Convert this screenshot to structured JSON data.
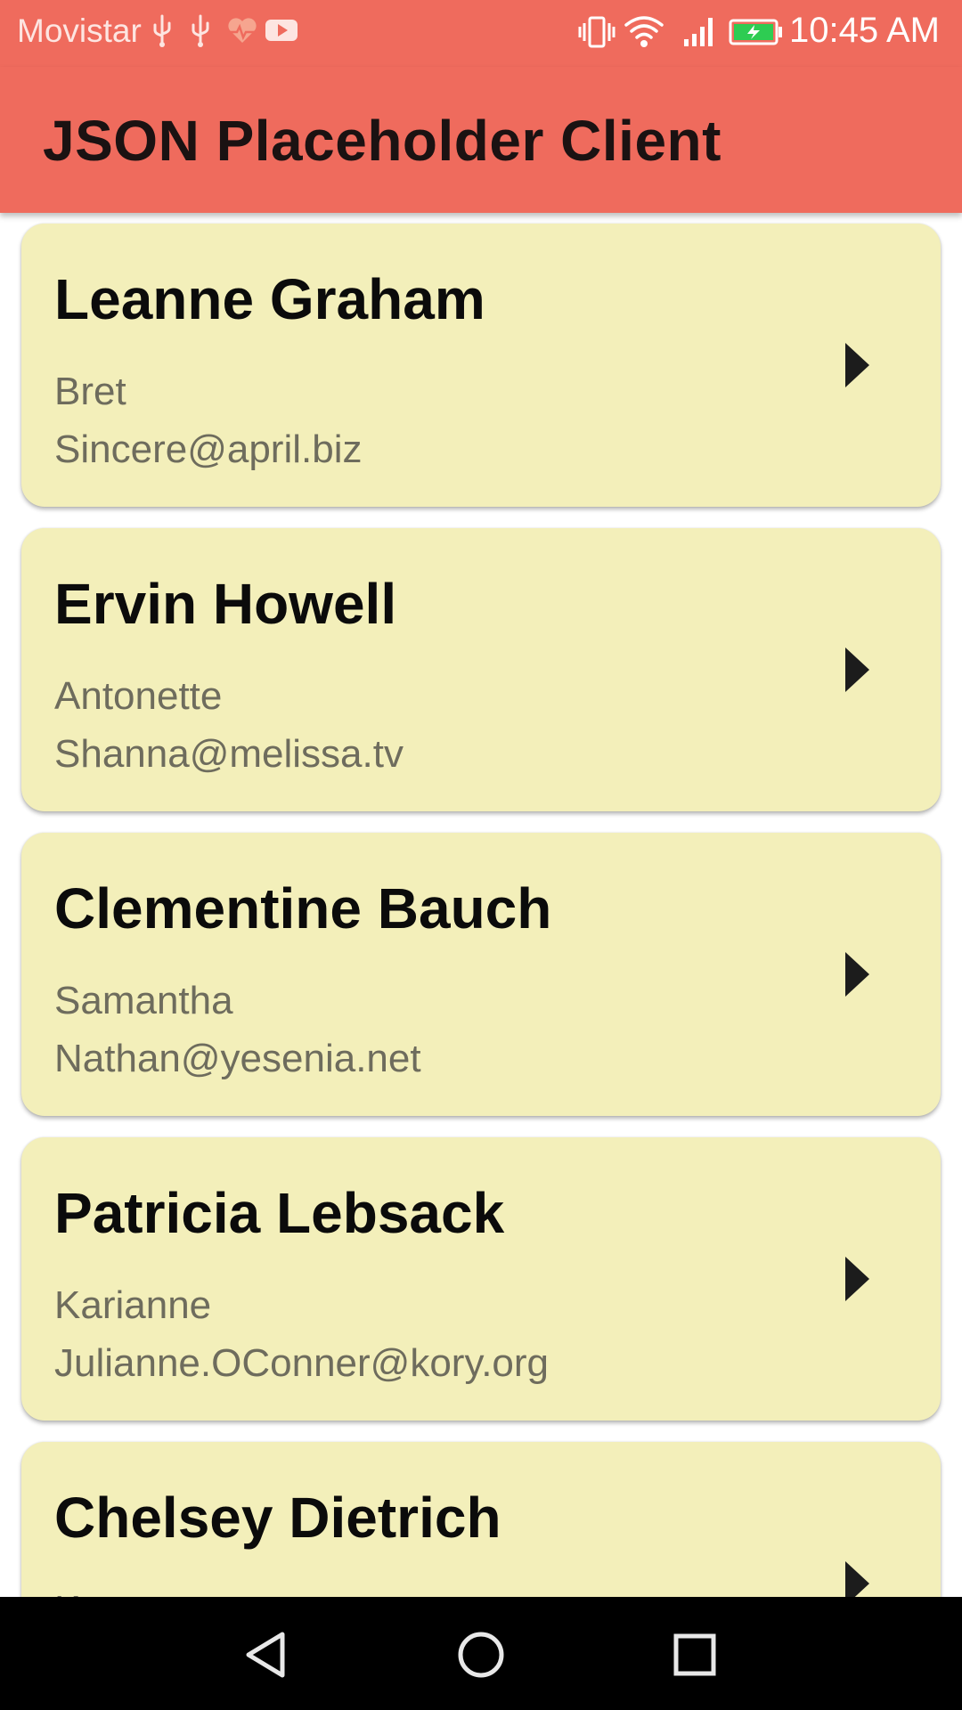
{
  "status_bar": {
    "carrier": "Movistar",
    "time": "10:45 AM",
    "icons": [
      "usb-icon",
      "usb-icon",
      "health-icon",
      "youtube-icon",
      "vibrate-icon",
      "wifi-icon",
      "signal-icon",
      "battery-charging-icon"
    ]
  },
  "app_bar": {
    "title": "JSON Placeholder Client"
  },
  "users": [
    {
      "name": "Leanne Graham",
      "username": "Bret",
      "email": "Sincere@april.biz"
    },
    {
      "name": "Ervin Howell",
      "username": "Antonette",
      "email": "Shanna@melissa.tv"
    },
    {
      "name": "Clementine Bauch",
      "username": "Samantha",
      "email": "Nathan@yesenia.net"
    },
    {
      "name": "Patricia Lebsack",
      "username": "Karianne",
      "email": "Julianne.OConner@kory.org"
    },
    {
      "name": "Chelsey Dietrich",
      "username": "Kamren",
      "email": ""
    }
  ],
  "nav_bar": {
    "buttons": [
      "back-icon",
      "home-icon",
      "recents-icon"
    ]
  },
  "colors": {
    "primary": "#ef6b5d",
    "card_background": "#f3efba",
    "title_text": "#1b1212",
    "secondary_text": "#6e6c5d"
  }
}
